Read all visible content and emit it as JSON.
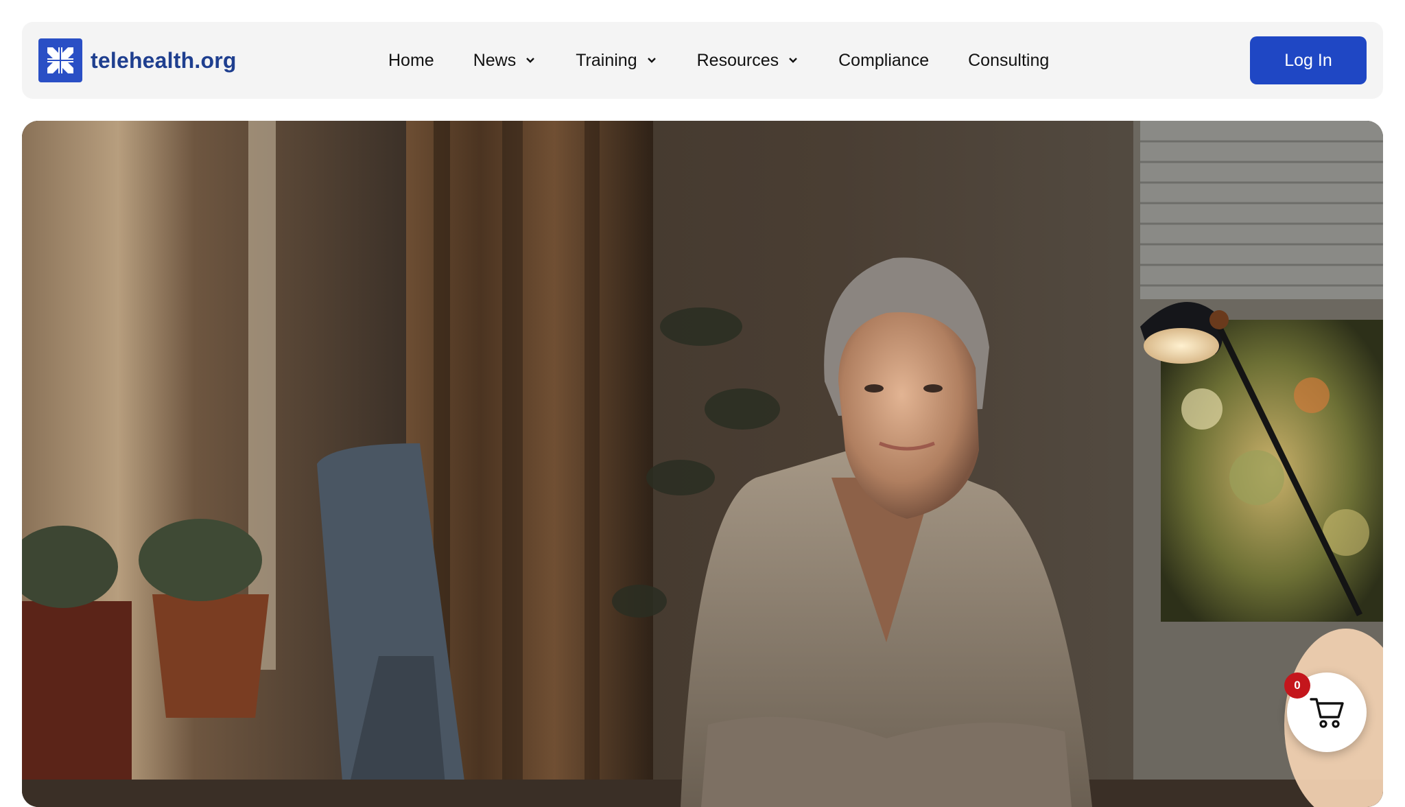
{
  "brand": {
    "name": "telehealth.org",
    "logo_icon": "arrows-inward-icon",
    "logo_color": "#2a4fc5"
  },
  "nav": {
    "items": [
      {
        "label": "Home",
        "has_dropdown": false
      },
      {
        "label": "News",
        "has_dropdown": true
      },
      {
        "label": "Training",
        "has_dropdown": true
      },
      {
        "label": "Resources",
        "has_dropdown": true
      },
      {
        "label": "Compliance",
        "has_dropdown": false
      },
      {
        "label": "Consulting",
        "has_dropdown": false
      }
    ]
  },
  "login": {
    "label": "Log In",
    "color": "#1f47c4"
  },
  "hero": {
    "image_icon": "hero-photo"
  },
  "cart": {
    "count": "0",
    "icon": "cart-icon",
    "badge_color": "#c4161c"
  }
}
